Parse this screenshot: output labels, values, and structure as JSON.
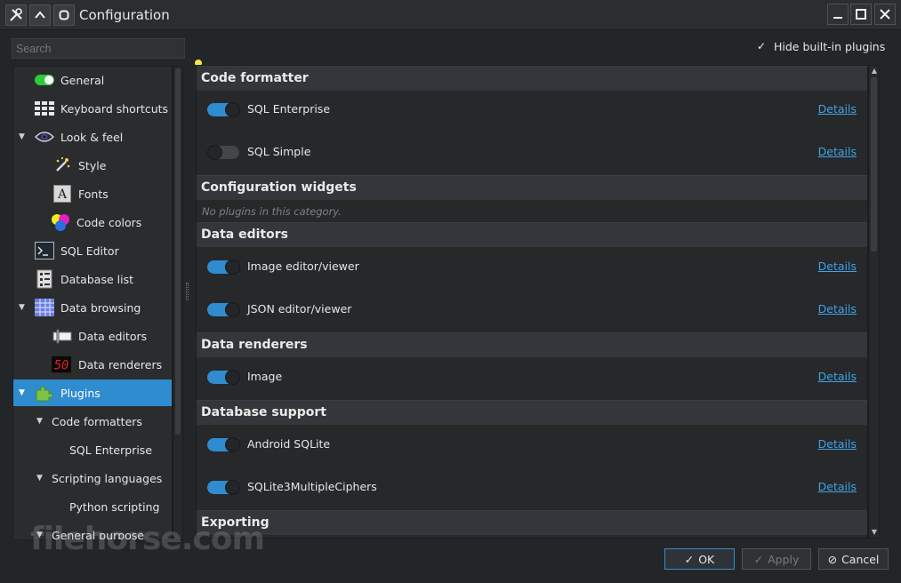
{
  "window": {
    "title": "Configuration",
    "buttons": {
      "minimize": "_",
      "maximize": "□",
      "close": "✕"
    }
  },
  "search": {
    "placeholder": "Search"
  },
  "hide_builtin": {
    "label": "Hide built-in plugins",
    "checked": true
  },
  "tree": [
    {
      "label": "General",
      "icon": "toggle-icon"
    },
    {
      "label": "Keyboard shortcuts",
      "icon": "keyboard-icon"
    },
    {
      "label": "Look & feel",
      "icon": "eye-icon",
      "expanded": true
    },
    {
      "label": "Style",
      "icon": "magic-wand-icon"
    },
    {
      "label": "Fonts",
      "icon": "font-icon"
    },
    {
      "label": "Code colors",
      "icon": "color-circles-icon"
    },
    {
      "label": "SQL Editor",
      "icon": "terminal-icon"
    },
    {
      "label": "Database list",
      "icon": "database-list-icon"
    },
    {
      "label": "Data browsing",
      "icon": "grid-icon",
      "expanded": true
    },
    {
      "label": "Data editors",
      "icon": "data-editor-icon"
    },
    {
      "label": "Data renderers",
      "icon": "digital-display-icon"
    },
    {
      "label": "Plugins",
      "icon": "puzzle-icon",
      "selected": true,
      "expanded": true
    },
    {
      "label": "Code formatters",
      "expanded": true
    },
    {
      "label": "SQL Enterprise"
    },
    {
      "label": "Scripting languages",
      "expanded": true
    },
    {
      "label": "Python scripting"
    },
    {
      "label": "General purpose",
      "expanded": true
    }
  ],
  "categories": [
    {
      "title": "Code formatter",
      "plugins": [
        {
          "name": "SQL Enterprise",
          "enabled": true,
          "details": "Details"
        },
        {
          "name": "SQL Simple",
          "enabled": false,
          "details": "Details"
        }
      ]
    },
    {
      "title": "Configuration widgets",
      "empty_text": "No plugins in this category.",
      "plugins": []
    },
    {
      "title": "Data editors",
      "plugins": [
        {
          "name": "Image editor/viewer",
          "enabled": true,
          "details": "Details"
        },
        {
          "name": "JSON editor/viewer",
          "enabled": true,
          "details": "Details"
        }
      ]
    },
    {
      "title": "Data renderers",
      "plugins": [
        {
          "name": "Image",
          "enabled": true,
          "details": "Details"
        }
      ]
    },
    {
      "title": "Database support",
      "plugins": [
        {
          "name": "Android SQLite",
          "enabled": true,
          "details": "Details"
        },
        {
          "name": "SQLite3MultipleCiphers",
          "enabled": true,
          "details": "Details"
        }
      ]
    },
    {
      "title": "Exporting",
      "plugins": []
    }
  ],
  "footer": {
    "ok": "OK",
    "apply": "Apply",
    "cancel": "Cancel"
  },
  "watermark": "filehorse.com",
  "colors": {
    "accent": "#2f8ccf",
    "link": "#3ea3e8"
  }
}
